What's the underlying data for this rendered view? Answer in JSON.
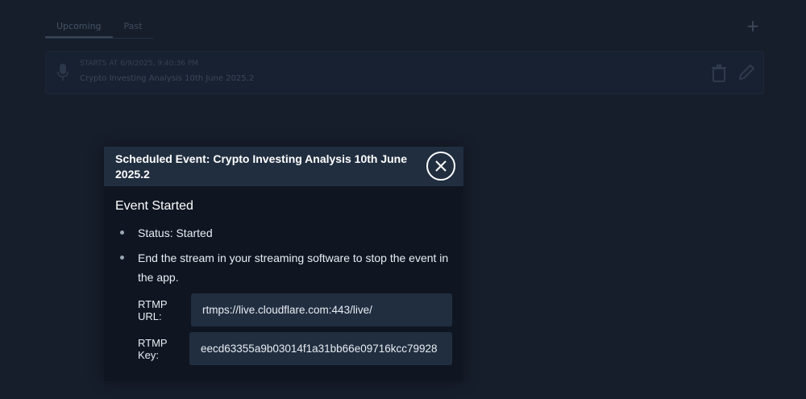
{
  "background": {
    "tabs": [
      {
        "label": "Upcoming",
        "active": true
      },
      {
        "label": "Past",
        "active": false
      }
    ],
    "add_icon": "plus-icon",
    "event_card": {
      "meta": "STARTS AT 6/9/2025, 9:40:36 PM",
      "title": "Crypto Investing Analysis 10th June 2025.2",
      "icons": [
        "microphone-icon",
        "trash-icon",
        "pencil-icon"
      ]
    }
  },
  "modal": {
    "title": "Scheduled Event: Crypto Investing Analysis 10th June 2025.2",
    "close_icon": "close-icon",
    "heading": "Event Started",
    "items": [
      "Status: Started",
      "End the stream in your streaming software to stop the event in the app."
    ],
    "rtmp_url_label": "RTMP URL:",
    "rtmp_url_value": "rtmps://live.cloudflare.com:443/live/",
    "rtmp_key_label": "RTMP Key:",
    "rtmp_key_value": "eecd63355a9b03014f1a31bb66e09716kcc79928"
  },
  "colors": {
    "page_bg": "#161e2b",
    "modal_bg": "#0f1622",
    "modal_header_bg": "#212e40",
    "field_bg": "#212e40",
    "text": "#ffffff"
  }
}
